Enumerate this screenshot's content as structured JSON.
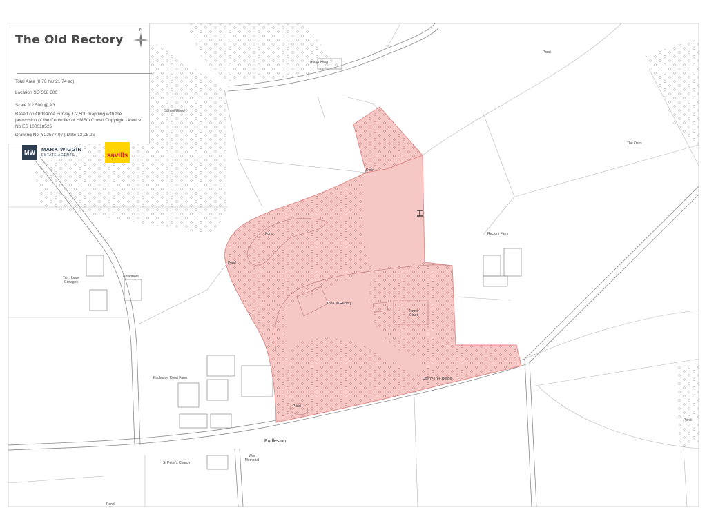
{
  "legend": {
    "title": "The Old Rectory",
    "total_area": "Total Area (8.76 ha/ 21.74 ac)",
    "location": "Location SO 568 600",
    "scale": "Scale 1:2,500 @ A3",
    "basis": "Based on Ordnance Survey 1:2,500 mapping with the permission of the Controller of HMSO Crown Copyright Licence No ES 100018525",
    "drawing": "Drawing No. Y22577-07 | Date 13.05.25",
    "north_label": "N"
  },
  "logos": {
    "agent_mark": "MW",
    "agent_name": "MARK WIGGIN",
    "agent_sub": "ESTATE AGENTS",
    "savills": "savills"
  },
  "colors": {
    "boundary_fill": "#f5c7c5",
    "boundary_stroke": "#e08f8d",
    "line": "#8a8a8a"
  },
  "map_labels": {
    "the_furlong": "The Furlong",
    "pond_ne": "Pond",
    "the_oaks": "The Oaks",
    "school_wood": "School Wood",
    "rectory_farm": "Rectory Farm",
    "the_old_rectory": "The Old Rectory",
    "tennis_court": "Tennis Court",
    "pond_north": "Pond",
    "pond_west": "Pond",
    "pond_south": "Pond",
    "tan_house": "Tan House Cottages",
    "rosemont": "Rosemont",
    "pudleston_court_farm": "Pudleston Court Farm",
    "cherry_tree_house": "Cherry Tree House",
    "pudleston": "Pudleston",
    "st_peters": "St Peter's Church",
    "war_memorial": "War Memorial",
    "pond_sw": "Pond",
    "pond_e": "Pond",
    "drain": "Drain"
  }
}
